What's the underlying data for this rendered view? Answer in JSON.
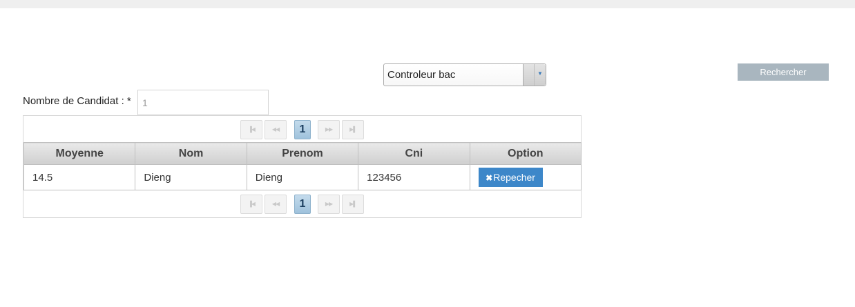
{
  "filter": {
    "select_value": "Controleur bac",
    "search_label": "Rechercher"
  },
  "form": {
    "count_label": "Nombre de Candidat : *",
    "count_value": "1"
  },
  "paginator": {
    "first_icon": "▐◀",
    "prev_icon": "◀◀",
    "current_page": "1",
    "next_icon": "▶▶",
    "last_icon": "▶▌"
  },
  "table": {
    "columns": [
      "Moyenne",
      "Nom",
      "Prenom",
      "Cni",
      "Option"
    ],
    "rows": [
      {
        "moyenne": "14.5",
        "nom": "Dieng",
        "prenom": "Dieng",
        "cni": "123456",
        "action_icon": "✖",
        "action_label": "Repecher"
      }
    ]
  },
  "colors": {
    "accent": "#3d87c9",
    "search_button": "#a9b6bf",
    "page_active": "#b3d1e7"
  }
}
